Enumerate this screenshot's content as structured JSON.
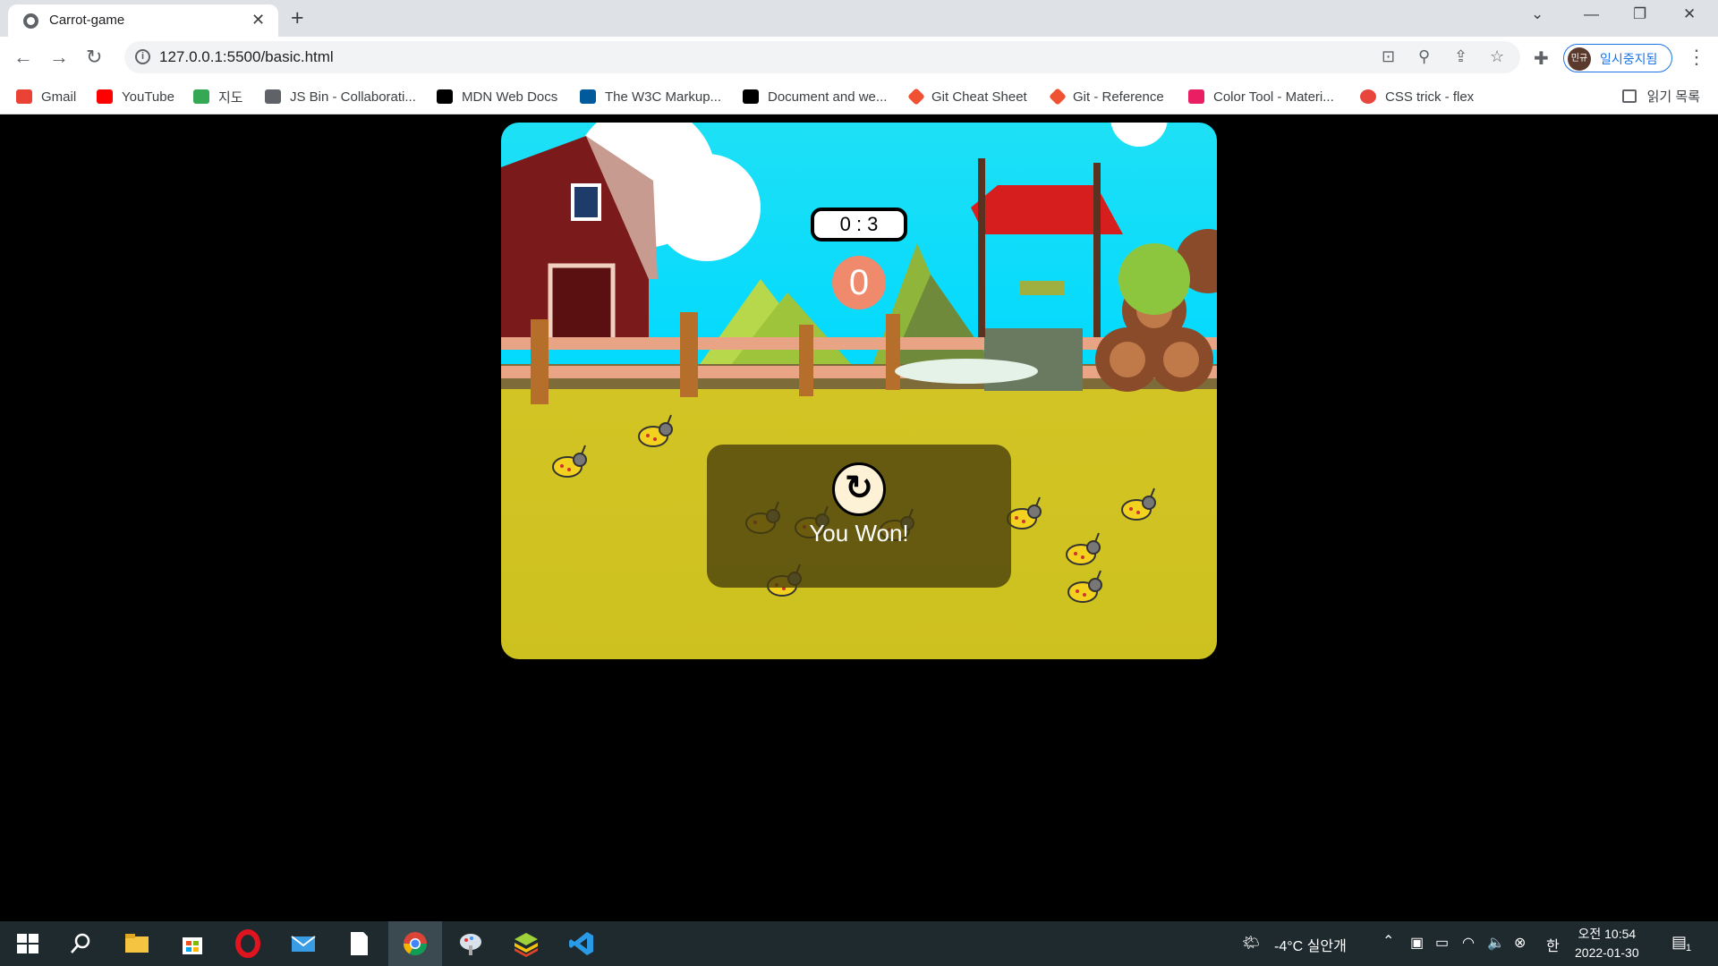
{
  "browser": {
    "tab_title": "Carrot-game",
    "url": "127.0.0.1:5500/basic.html",
    "profile_initials": "민규",
    "profile_label": "일시중지됨"
  },
  "bookmarks": [
    {
      "label": "Gmail",
      "color": "#ea4335"
    },
    {
      "label": "YouTube",
      "color": "#ff0000"
    },
    {
      "label": "지도",
      "color": "#34a853"
    },
    {
      "label": "JS Bin - Collaborati...",
      "color": "#5f6368"
    },
    {
      "label": "MDN Web Docs",
      "color": "#000000"
    },
    {
      "label": "The W3C Markup...",
      "color": "#005a9c"
    },
    {
      "label": "Document and we...",
      "color": "#000000"
    },
    {
      "label": "Git Cheat Sheet",
      "color": "#f05133"
    },
    {
      "label": "Git - Reference",
      "color": "#f05133"
    },
    {
      "label": "Color Tool - Materi...",
      "color": "#e91e63"
    },
    {
      "label": "CSS trick - flex",
      "color": "#e8453c"
    }
  ],
  "reading_list": "읽기 목록",
  "game": {
    "timer": "0 : 3",
    "score": "0",
    "popup_message": "You Won!",
    "colors": {
      "sky": "#00d9ff",
      "field": "#cdc11f",
      "score": "#f08a6c"
    }
  },
  "taskbar": {
    "weather": "-4°C  실안개",
    "ime": "한",
    "time": "오전 10:54",
    "date": "2022-01-30",
    "notifications": "1"
  }
}
